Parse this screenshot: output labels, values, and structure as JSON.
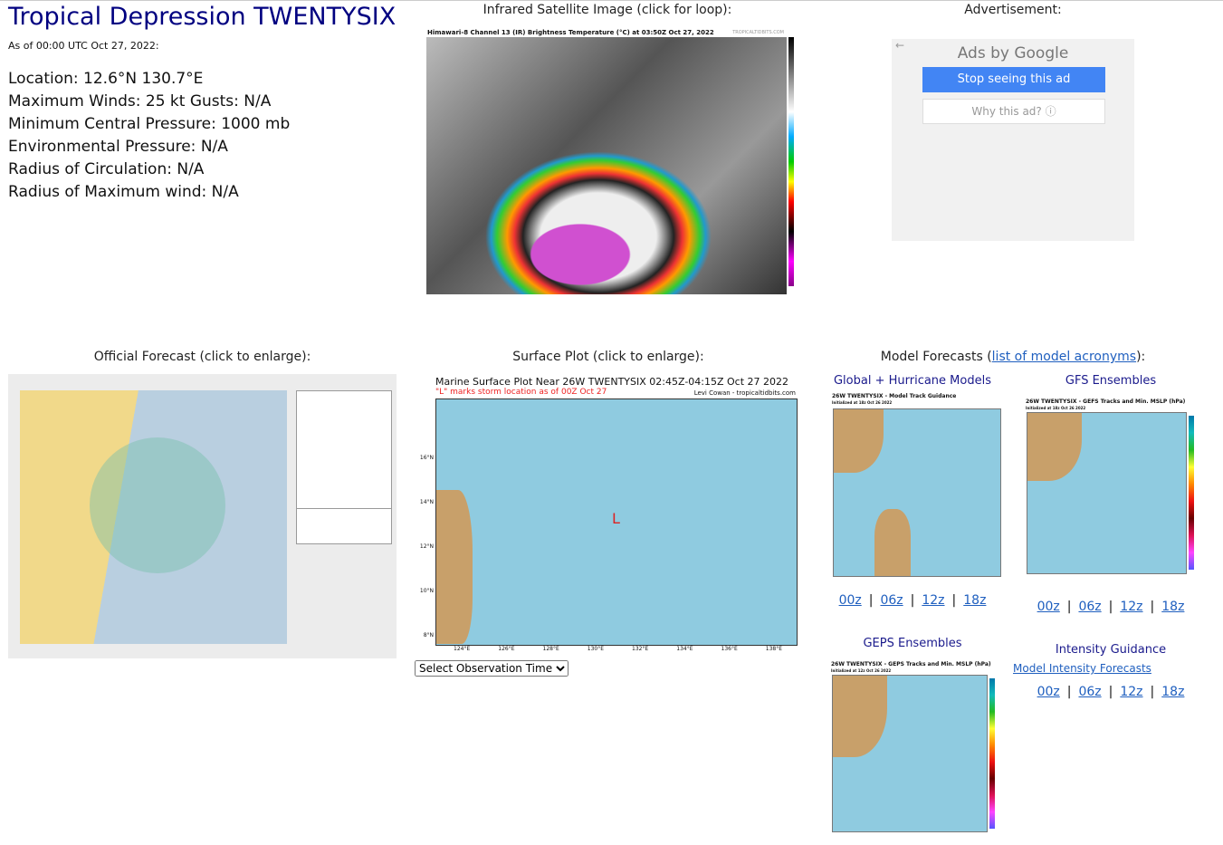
{
  "storm": {
    "title": "Tropical Depression TWENTYSIX",
    "as_of": "As of 00:00 UTC Oct 27, 2022:",
    "stats": [
      "Location: 12.6°N 130.7°E",
      "Maximum Winds: 25 kt  Gusts: N/A",
      "Minimum Central Pressure: 1000 mb",
      "Environmental Pressure: N/A",
      "Radius of Circulation: N/A",
      "Radius of Maximum wind: N/A"
    ]
  },
  "satellite": {
    "heading": "Infrared Satellite Image (click for loop):",
    "caption": "Himawari-8 Channel 13 (IR) Brightness Temperature (°C) at 03:50Z Oct 27, 2022",
    "credit": "TROPICALTIDBITS.COM"
  },
  "ad": {
    "heading": "Advertisement:",
    "ads_by": "Ads by Google",
    "stop": "Stop seeing this ad",
    "why": "Why this ad? ⓘ"
  },
  "official": {
    "heading": "Official Forecast (click to enlarge):"
  },
  "surface": {
    "heading": "Surface Plot (click to enlarge):",
    "title": "Marine Surface Plot Near 26W TWENTYSIX 02:45Z-04:15Z Oct 27 2022",
    "subtitle": "\"L\" marks storm location as of 00Z Oct 27",
    "credit": "Levi Cowan - tropicaltidbits.com",
    "marker": "L",
    "lat_labels": [
      "16°N",
      "14°N",
      "12°N",
      "10°N",
      "8°N"
    ],
    "lon_labels": [
      "124°E",
      "126°E",
      "128°E",
      "130°E",
      "132°E",
      "134°E",
      "136°E",
      "138°E"
    ],
    "select": "Select Observation Time..."
  },
  "models": {
    "heading": "Model Forecasts (",
    "link": "list of model acronyms",
    "heading_end": "):",
    "global": {
      "heading": "Global + Hurricane Models",
      "caption": "26W TWENTYSIX - Model Track Guidance",
      "init": "Initialized at 18z Oct 26 2022"
    },
    "gfs": {
      "heading": "GFS Ensembles",
      "caption": "26W TWENTYSIX - GEFS Tracks and Min. MSLP (hPa)",
      "init": "Initialized at 18z Oct 26 2022"
    },
    "geps": {
      "heading": "GEPS Ensembles",
      "caption": "26W TWENTYSIX - GEPS Tracks and Min. MSLP (hPa)",
      "init": "Initialized at 12z Oct 26 2022"
    },
    "intensity": {
      "heading": "Intensity Guidance",
      "link": "Model Intensity Forecasts"
    },
    "runs": [
      "00z",
      "06z",
      "12z",
      "18z"
    ]
  },
  "colors": {
    "title": "#000080",
    "ocean": "#8fcbe0",
    "land": "#c8a06a",
    "link": "#1f5fbf",
    "ad_button": "#4285f4"
  }
}
